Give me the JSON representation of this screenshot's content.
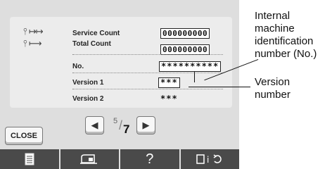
{
  "info": {
    "service_label": "Service Count",
    "service_value": "000000000",
    "total_label": "Total Count",
    "total_value": "000000000",
    "no_label": "No.",
    "no_value": "**********",
    "v1_label": "Version 1",
    "v1_value": "***",
    "v2_label": "Version 2",
    "v2_value": "***"
  },
  "pager": {
    "current": "5",
    "slash": "/",
    "total": "7",
    "prev_icon": "left-arrow-icon",
    "next_icon": "right-arrow-icon"
  },
  "close_label": "CLOSE",
  "bottom_bar": {
    "help": "?",
    "icons": [
      "page-icon",
      "machine-icon",
      "help-icon",
      "settings-icon"
    ]
  },
  "annotations": {
    "id_lines": [
      "Internal",
      "machine",
      "identification",
      "number (No.)"
    ],
    "version_lines": [
      "Version",
      "number"
    ]
  },
  "colors": {
    "panel": "#ececec",
    "screen": "#dedede",
    "bottom_bar": "#4a4a4a"
  }
}
